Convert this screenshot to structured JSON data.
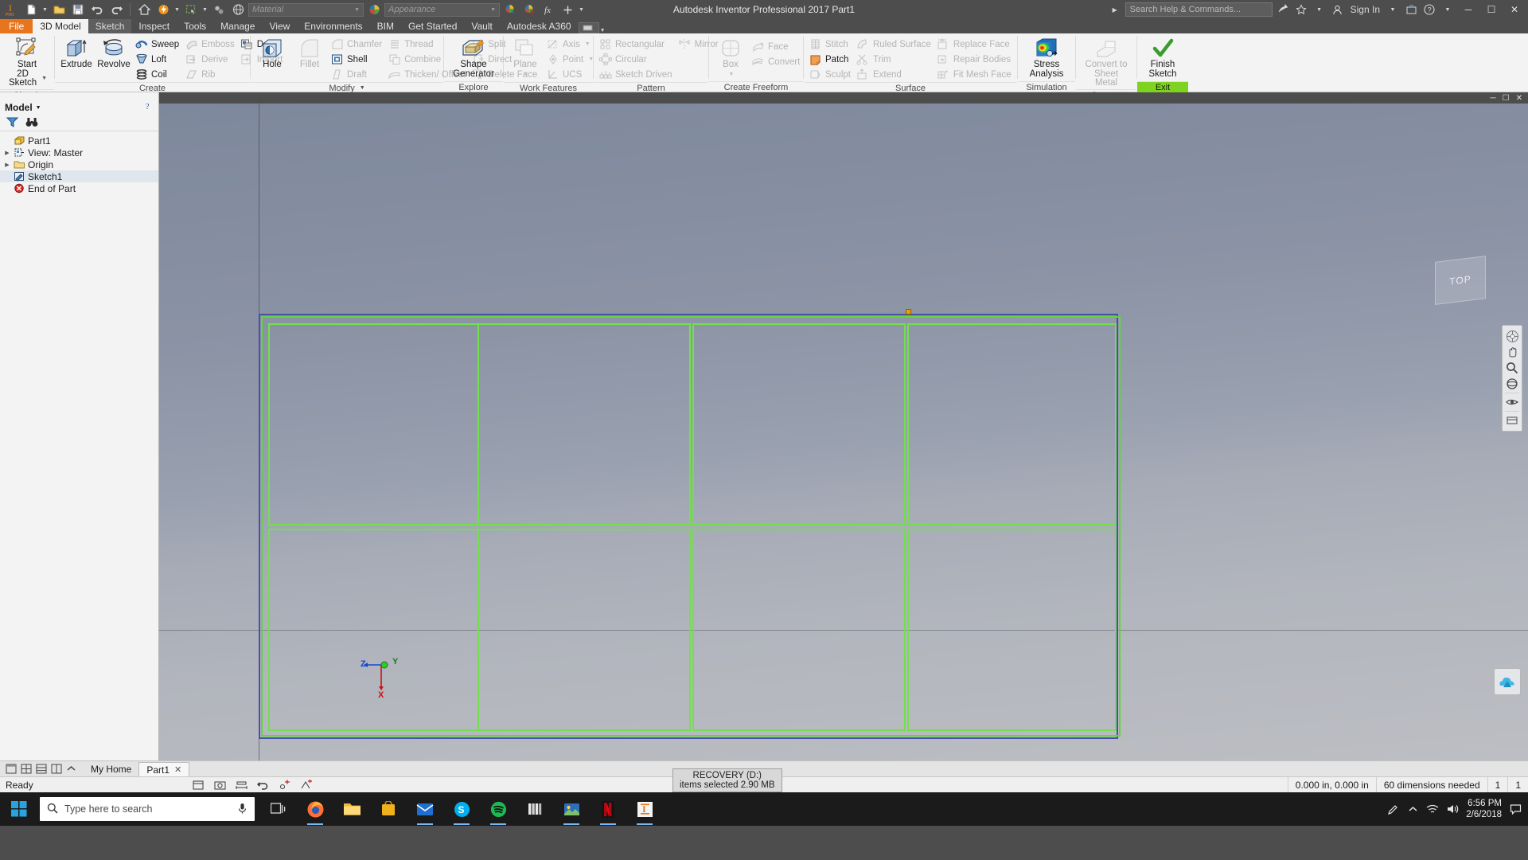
{
  "titlebar": {
    "app_title": "Autodesk Inventor Professional 2017",
    "doc_title": "Part1",
    "title_full": "Autodesk Inventor Professional 2017   Part1",
    "material_placeholder": "Material",
    "appearance_placeholder": "Appearance",
    "help_placeholder": "Search Help & Commands...",
    "signin_label": "Sign In",
    "minimize": "─",
    "maximize": "☐",
    "close": "✕"
  },
  "tabs": [
    {
      "label": "File",
      "state": "file"
    },
    {
      "label": "3D Model",
      "state": "active"
    },
    {
      "label": "Sketch",
      "state": "semi"
    },
    {
      "label": "Inspect",
      "state": "normal"
    },
    {
      "label": "Tools",
      "state": "normal"
    },
    {
      "label": "Manage",
      "state": "normal"
    },
    {
      "label": "View",
      "state": "normal"
    },
    {
      "label": "Environments",
      "state": "normal"
    },
    {
      "label": "BIM",
      "state": "normal"
    },
    {
      "label": "Get Started",
      "state": "normal"
    },
    {
      "label": "Vault",
      "state": "normal"
    },
    {
      "label": "Autodesk A360",
      "state": "normal"
    }
  ],
  "ribbon": {
    "panels": [
      {
        "name": "Sketch",
        "big": [
          {
            "label": "Start\n2D Sketch",
            "label1": "Start",
            "label2": "2D Sketch",
            "enabled": true,
            "dropdown": true,
            "icon": "sketch-icon"
          }
        ]
      },
      {
        "name": "Create",
        "big": [
          {
            "label1": "Extrude",
            "label2": "",
            "enabled": true,
            "icon": "extrude-icon"
          },
          {
            "label1": "Revolve",
            "label2": "",
            "enabled": true,
            "icon": "revolve-icon"
          }
        ],
        "small": [
          {
            "label": "Sweep",
            "enabled": true,
            "icon": "sweep-icon"
          },
          {
            "label": "Loft",
            "enabled": true,
            "icon": "loft-icon"
          },
          {
            "label": "Coil",
            "enabled": true,
            "icon": "coil-icon"
          },
          {
            "label": "Emboss",
            "enabled": false,
            "icon": "emboss-icon"
          },
          {
            "label": "Derive",
            "enabled": false,
            "icon": "derive-icon"
          },
          {
            "label": "Rib",
            "enabled": false,
            "icon": "rib-icon"
          },
          {
            "label": "Decal",
            "enabled": true,
            "icon": "decal-icon"
          },
          {
            "label": "Import",
            "enabled": false,
            "icon": "import-icon"
          }
        ]
      },
      {
        "name": "Modify",
        "dropdown": true,
        "big": [
          {
            "label1": "Hole",
            "enabled": true,
            "icon": "hole-icon"
          },
          {
            "label1": "Fillet",
            "enabled": false,
            "icon": "fillet-icon"
          }
        ],
        "small": [
          {
            "label": "Chamfer",
            "enabled": false,
            "icon": "chamfer-icon"
          },
          {
            "label": "Shell",
            "enabled": true,
            "icon": "shell-icon"
          },
          {
            "label": "Draft",
            "enabled": false,
            "icon": "draft-icon"
          },
          {
            "label": "Thread",
            "enabled": false,
            "icon": "thread-icon"
          },
          {
            "label": "Combine",
            "enabled": false,
            "icon": "combine-icon"
          },
          {
            "label": "Thicken/ Offset",
            "enabled": false,
            "icon": "thicken-icon"
          },
          {
            "label": "Split",
            "enabled": false,
            "icon": "split-icon"
          },
          {
            "label": "Direct",
            "enabled": false,
            "icon": "direct-icon"
          },
          {
            "label": "Delete Face",
            "enabled": false,
            "icon": "delete-face-icon"
          }
        ]
      },
      {
        "name": "Explore",
        "big": [
          {
            "label1": "Shape",
            "label2": "Generator",
            "enabled": true,
            "icon": "shape-generator-icon"
          }
        ]
      },
      {
        "name": "Work Features",
        "big": [
          {
            "label1": "Plane",
            "enabled": false,
            "dropdown": true,
            "icon": "plane-icon"
          }
        ],
        "small": [
          {
            "label": "Axis",
            "enabled": false,
            "dropdown": true,
            "icon": "axis-icon"
          },
          {
            "label": "Point",
            "enabled": false,
            "dropdown": true,
            "icon": "point-icon"
          },
          {
            "label": "UCS",
            "enabled": false,
            "icon": "ucs-icon"
          }
        ]
      },
      {
        "name": "Pattern",
        "small": [
          {
            "label": "Rectangular",
            "enabled": false,
            "icon": "rectangular-pattern-icon"
          },
          {
            "label": "Circular",
            "enabled": false,
            "icon": "circular-pattern-icon"
          },
          {
            "label": "Sketch Driven",
            "enabled": false,
            "icon": "sketch-driven-icon"
          },
          {
            "label": "Mirror",
            "enabled": false,
            "icon": "mirror-icon"
          }
        ]
      },
      {
        "name": "Create Freeform",
        "big": [
          {
            "label1": "Box",
            "enabled": false,
            "dropdown": true,
            "icon": "box-icon"
          }
        ],
        "small": [
          {
            "label": "Face",
            "enabled": false,
            "icon": "face-icon"
          },
          {
            "label": "Convert",
            "enabled": false,
            "icon": "convert-freeform-icon"
          }
        ]
      },
      {
        "name": "Surface",
        "small": [
          {
            "label": "Stitch",
            "enabled": false,
            "icon": "stitch-icon"
          },
          {
            "label": "Patch",
            "enabled": true,
            "icon": "patch-icon"
          },
          {
            "label": "Sculpt",
            "enabled": false,
            "icon": "sculpt-icon"
          },
          {
            "label": "Ruled Surface",
            "enabled": false,
            "icon": "ruled-surface-icon"
          },
          {
            "label": "Trim",
            "enabled": false,
            "icon": "trim-icon"
          },
          {
            "label": "Extend",
            "enabled": false,
            "icon": "extend-icon"
          },
          {
            "label": "Replace Face",
            "enabled": false,
            "icon": "replace-face-icon"
          },
          {
            "label": "Repair Bodies",
            "enabled": false,
            "icon": "repair-bodies-icon"
          },
          {
            "label": "Fit Mesh Face",
            "enabled": false,
            "icon": "fit-mesh-face-icon"
          }
        ]
      },
      {
        "name": "Simulation",
        "big": [
          {
            "label1": "Stress",
            "label2": "Analysis",
            "enabled": true,
            "icon": "stress-analysis-icon"
          }
        ]
      },
      {
        "name": "Convert",
        "big": [
          {
            "label1": "Convert to",
            "label2": "Sheet Metal",
            "enabled": false,
            "icon": "convert-sheet-metal-icon"
          }
        ]
      },
      {
        "name": "Exit",
        "name_highlight": true,
        "big": [
          {
            "label1": "Finish",
            "label2": "Sketch",
            "enabled": true,
            "icon": "finish-sketch-icon"
          }
        ]
      }
    ]
  },
  "browser": {
    "title": "Model",
    "filter_icon": "filter-icon",
    "find_icon": "binoculars-icon",
    "help_icon": "question-mark-icon",
    "close_icon": "close-icon",
    "tree": [
      {
        "label": "Part1",
        "icon": "part-icon",
        "indent": 0,
        "arrow": false,
        "selected": false
      },
      {
        "label": "View: Master",
        "icon": "view-icon",
        "indent": 0,
        "arrow": true,
        "selected": false
      },
      {
        "label": "Origin",
        "icon": "folder-icon",
        "indent": 0,
        "arrow": true,
        "selected": false
      },
      {
        "label": "Sketch1",
        "icon": "sketch-node-icon",
        "indent": 1,
        "arrow": false,
        "selected": true
      },
      {
        "label": "End of Part",
        "icon": "end-of-part-icon",
        "indent": 1,
        "arrow": false,
        "selected": false
      }
    ]
  },
  "viewport": {
    "minimize": "─",
    "maximize": "☐",
    "close": "✕",
    "viewcube_label": "TOP",
    "triad": {
      "z": "Z",
      "y": "Y",
      "x": "X"
    }
  },
  "doctabs": {
    "tabs": [
      {
        "label": "My Home",
        "active": false,
        "closable": false
      },
      {
        "label": "Part1",
        "active": true,
        "closable": true,
        "close": "✕"
      }
    ]
  },
  "statusbar": {
    "message": "Ready",
    "coordinates": "0.000 in, 0.000 in",
    "dimensions": "60 dimensions needed",
    "count1": "1",
    "count2": "1"
  },
  "taskbar": {
    "search_placeholder": "Type here to search",
    "time": "6:56 PM",
    "date": "2/6/2018",
    "apps": [
      {
        "name": "task-view-icon"
      },
      {
        "name": "firefox-icon"
      },
      {
        "name": "file-explorer-icon"
      },
      {
        "name": "store-icon"
      },
      {
        "name": "mail-icon"
      },
      {
        "name": "skype-icon"
      },
      {
        "name": "spotify-icon"
      },
      {
        "name": "books-icon"
      },
      {
        "name": "photos-icon"
      },
      {
        "name": "netflix-icon"
      },
      {
        "name": "inventor-icon"
      }
    ],
    "tooltip_line1": "RECOVERY (D:)",
    "tooltip_line2": "items selected  2.90 MB"
  }
}
